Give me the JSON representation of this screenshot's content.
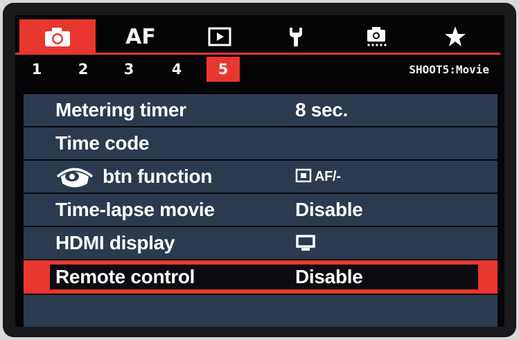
{
  "tabs": [
    {
      "id": "shoot",
      "icon": "camera-icon",
      "active": true
    },
    {
      "id": "af",
      "label": "AF",
      "active": false
    },
    {
      "id": "playback",
      "icon": "playback-icon",
      "active": false
    },
    {
      "id": "setup",
      "icon": "wrench-icon",
      "active": false
    },
    {
      "id": "custom",
      "icon": "custom-functions-icon",
      "active": false
    },
    {
      "id": "mymenu",
      "icon": "star-icon",
      "active": false
    }
  ],
  "pages": [
    "1",
    "2",
    "3",
    "4",
    "5"
  ],
  "active_page": "5",
  "screen_title": "SHOOT5:Movie",
  "menu": [
    {
      "label": "Metering timer",
      "value": "8 sec."
    },
    {
      "label": "Time code",
      "value": ""
    },
    {
      "label": "btn function",
      "label_icon": "eye-icon",
      "value": "AF/-",
      "value_icon": "af-lock-icon"
    },
    {
      "label": "Time-lapse movie",
      "value": "Disable"
    },
    {
      "label": "HDMI display",
      "value": "",
      "value_icon": "monitor-icon"
    },
    {
      "label": "Remote control",
      "value": "Disable",
      "selected": true
    }
  ],
  "colors": {
    "accent": "#e8372f",
    "row_bg": "#2c3a4f",
    "screen_bg": "#050508"
  }
}
